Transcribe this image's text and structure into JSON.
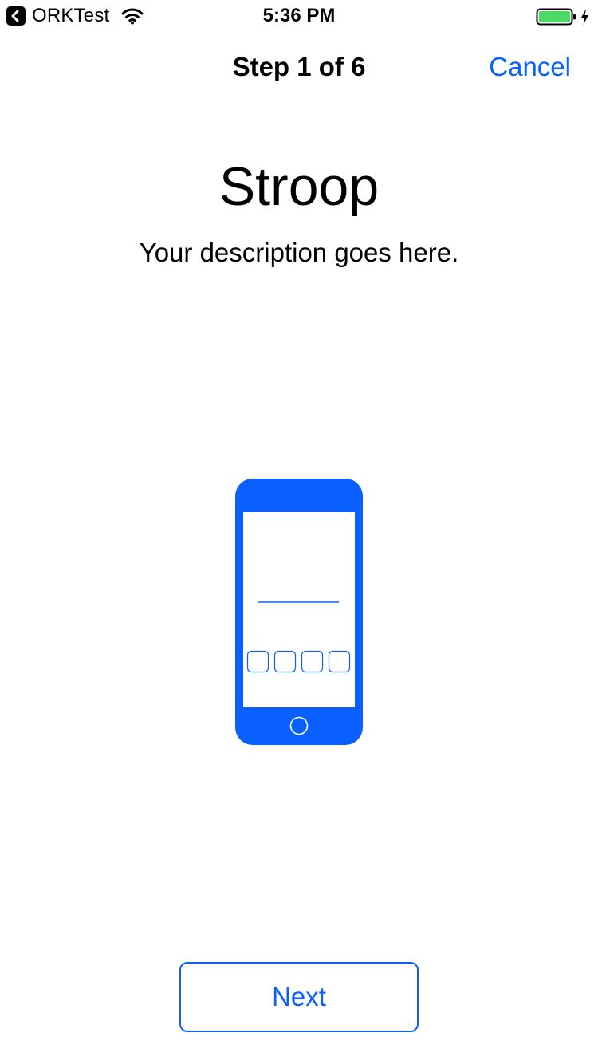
{
  "status_bar": {
    "back_app_label": "ORKTest",
    "time": "5:36 PM",
    "back_icon": "chevron-left-icon",
    "wifi_icon": "wifi-icon",
    "battery_icon": "battery-icon",
    "charging_icon": "bolt-icon",
    "battery_level": 1.0,
    "battery_color": "#4CD964"
  },
  "nav": {
    "title": "Step 1 of 6",
    "cancel_label": "Cancel"
  },
  "content": {
    "title": "Stroop",
    "description": "Your description goes here.",
    "illustration_icon": "phone-stroop-illustration"
  },
  "footer": {
    "next_label": "Next"
  },
  "colors": {
    "tint": "#0A60FF",
    "link_blue": "#0A60FF",
    "text": "#000000",
    "background": "#FFFFFF"
  }
}
